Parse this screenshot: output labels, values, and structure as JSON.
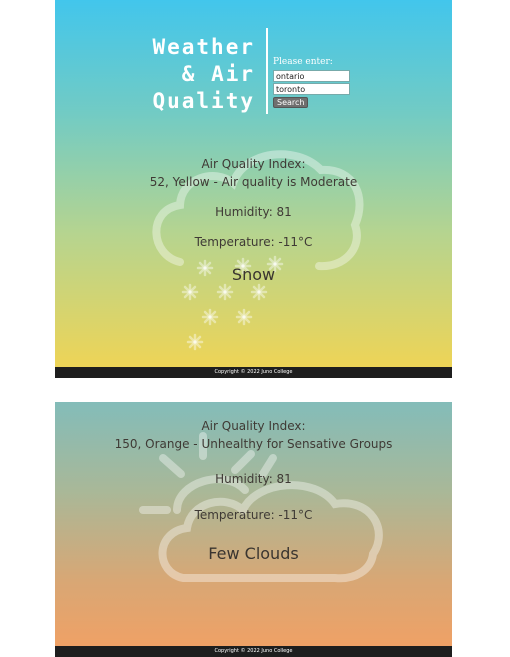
{
  "header": {
    "title": "Weather\n& Air\nQuality"
  },
  "search": {
    "prompt": "Please enter:",
    "province_value": "ontario",
    "city_value": "toronto",
    "button_label": "Search"
  },
  "results": [
    {
      "aqi_label": "Air Quality Index:",
      "aqi_value": "52, Yellow - Air quality is Moderate",
      "humidity": "Humidity: 81",
      "temperature": "Temperature: -11°C",
      "condition": "Snow",
      "icon": "snow-cloud-icon"
    },
    {
      "aqi_label": "Air Quality Index:",
      "aqi_value": "150, Orange - Unhealthy for Sensative Groups",
      "humidity": "Humidity: 81",
      "temperature": "Temperature: -11°C",
      "condition": "Few Clouds",
      "icon": "sun-cloud-icon"
    }
  ],
  "footer": {
    "copyright": "Copyright © 2022 Juno College"
  },
  "colors": {
    "panel1_gradient": [
      "#42c6ec",
      "#f2d452"
    ],
    "panel2_gradient": [
      "#83bcb9",
      "#f3a063"
    ],
    "footer": "#1e1e1e"
  }
}
